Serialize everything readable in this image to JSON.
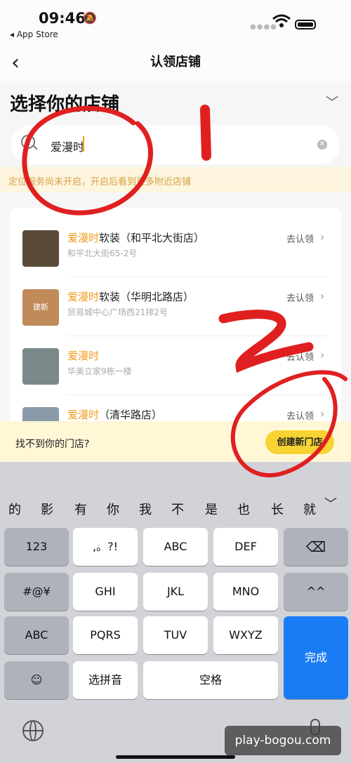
{
  "status_bar": {
    "time": "09:46",
    "back_app": "◂ App Store"
  },
  "nav": {
    "title": "认领店铺"
  },
  "page": {
    "title": "选择你的店铺"
  },
  "search": {
    "value": "爱漫时"
  },
  "notice": {
    "text": "定位服务尚未开启，开启后看到更多附近店铺"
  },
  "stores": [
    {
      "name_highlight": "爱漫时",
      "name_rest": "软装（和平北大街店）",
      "address": "和平北大街65-2号",
      "action": "去认领",
      "thumb_text": "",
      "thumb_color": "#5a4a3a"
    },
    {
      "name_highlight": "爱漫时",
      "name_rest": "软装（华明北路店）",
      "address": "贸易城中心广场西21排2号",
      "action": "去认领",
      "thumb_text": "建新",
      "thumb_color": "#c08a5a"
    },
    {
      "name_highlight": "爱漫时",
      "name_rest": "",
      "address": "华美立家9栋一楼",
      "action": "去认领",
      "thumb_text": "",
      "thumb_color": "#7a8a8a"
    },
    {
      "name_highlight": "爱漫时",
      "name_rest": "（清华路店）",
      "address": "",
      "action": "去认领",
      "thumb_text": "",
      "thumb_color": "#8a9aa8"
    }
  ],
  "bottom_bar": {
    "prompt": "找不到你的门店?",
    "create_label": "创建新门店"
  },
  "keyboard": {
    "candidates": [
      "的",
      "影",
      "有",
      "你",
      "我",
      "不",
      "是",
      "也",
      "长",
      "就"
    ],
    "rows": [
      [
        "123",
        ",。?!",
        "ABC",
        "DEF",
        "⌫"
      ],
      [
        "#@¥",
        "GHI",
        "JKL",
        "MNO",
        "^^"
      ],
      [
        "ABC",
        "PQRS",
        "TUV",
        "WXYZ"
      ],
      [
        "☺",
        "选拼音",
        "空格"
      ]
    ],
    "done_label": "完成"
  },
  "watermark": "play-bogou.com",
  "colors": {
    "highlight": "#f29b1c",
    "create_button": "#f7d433",
    "done_key": "#1a7cf5",
    "annotation": "#e02020"
  }
}
